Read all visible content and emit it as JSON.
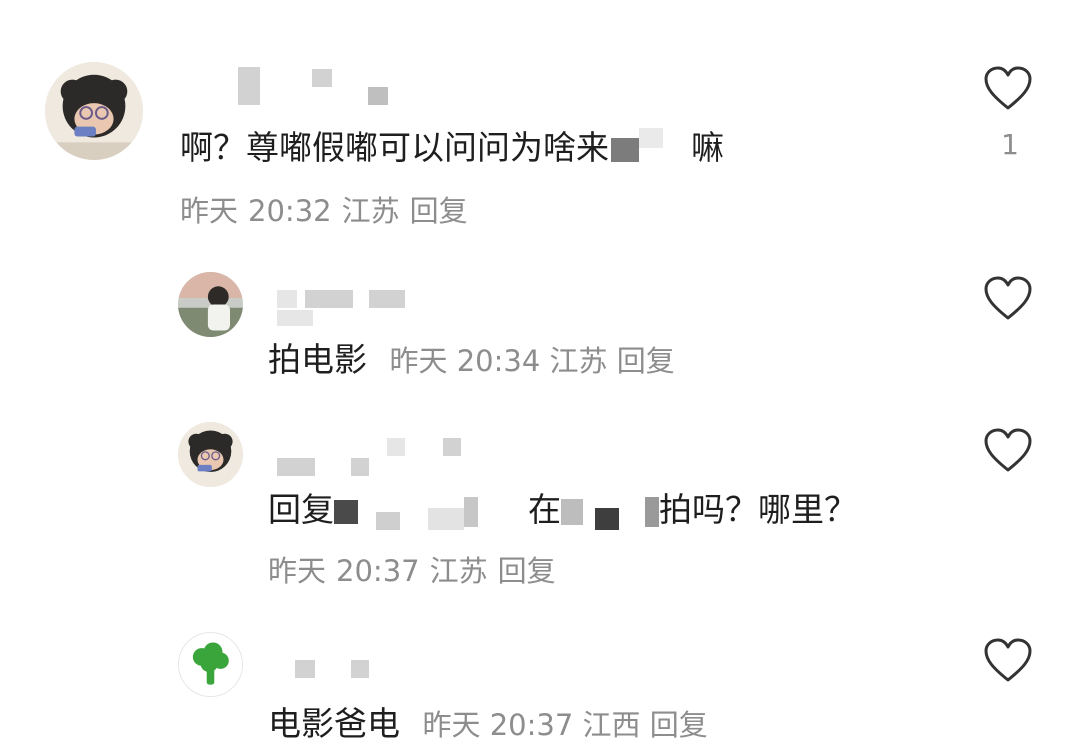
{
  "comments": [
    {
      "text": "啊？尊嘟假嘟可以问问为啥来",
      "text_tail": "嘛",
      "date": "昨天",
      "time": "20:32",
      "location": "江苏",
      "reply_label": "回复",
      "like_count": "1"
    },
    {
      "text": "拍电影",
      "date": "昨天",
      "time": "20:34",
      "location": "江苏",
      "reply_label": "回复"
    },
    {
      "text_prefix": "回复",
      "text_mid": "在",
      "text_end": "拍吗？哪里？",
      "date": "昨天",
      "time": "20:37",
      "location": "江苏",
      "reply_label": "回复"
    },
    {
      "text": "电影爸电",
      "date": "昨天",
      "time": "20:37",
      "location": "江西",
      "reply_label": "回复"
    }
  ],
  "icons": {
    "like": "heart-outline-icon",
    "avatar4": "broccoli-icon"
  },
  "colors": {
    "meta": "#8d8d8d",
    "text": "#1e1e1e",
    "heart_stroke": "#333333",
    "broccoli": "#3aa53a"
  }
}
